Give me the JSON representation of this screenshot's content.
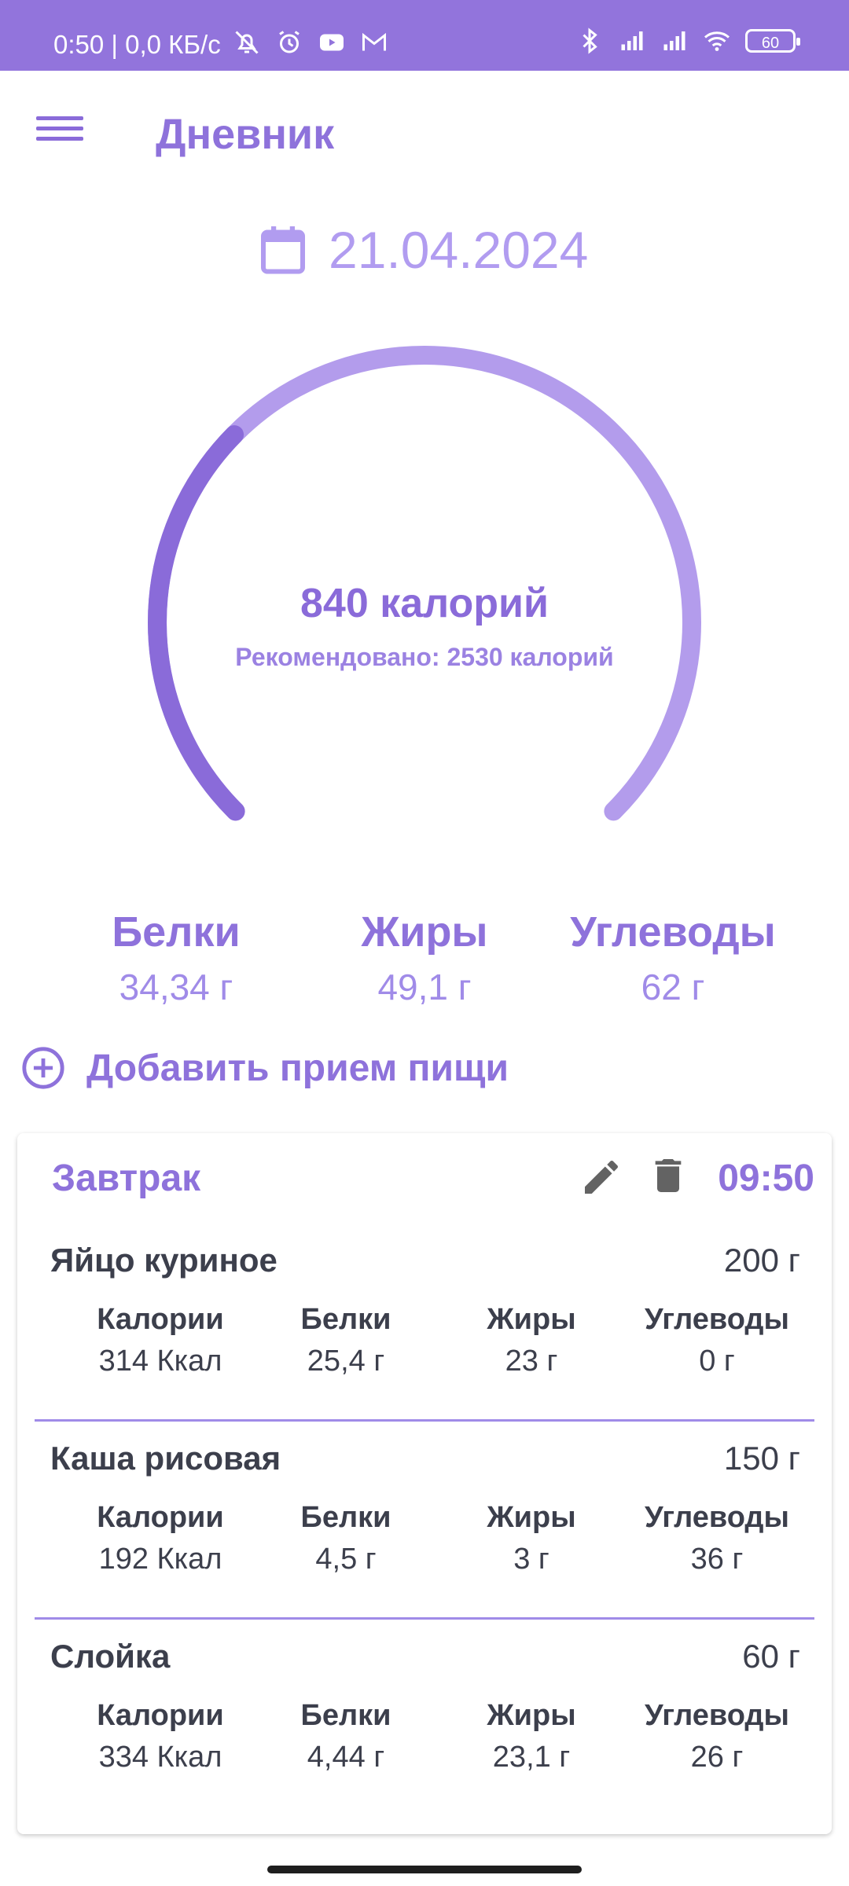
{
  "status_bar": {
    "time_text": "0:50 | 0,0 КБ/с",
    "battery": "60",
    "icons": [
      "bell-off-icon",
      "alarm-icon",
      "youtube-icon",
      "gmail-icon",
      "bluetooth-icon",
      "signal-icon",
      "signal-icon",
      "wifi-icon",
      "battery-icon"
    ]
  },
  "header": {
    "title": "Дневник"
  },
  "date": {
    "value": "21.04.2024",
    "icon": "calendar-icon"
  },
  "calories": {
    "current_label": "840 калорий",
    "recommended_label": "Рекомендовано: 2530 калорий",
    "current": 840,
    "recommended": 2530,
    "colors": {
      "progress": "#8a6bd9",
      "track": "#b39cec"
    }
  },
  "macros": [
    {
      "label": "Белки",
      "value": "34,34 г"
    },
    {
      "label": "Жиры",
      "value": "49,1 г"
    },
    {
      "label": "Углеводы",
      "value": "62 г"
    }
  ],
  "add_meal": {
    "label": "Добавить прием пищи",
    "icon": "add-circle-icon"
  },
  "meal": {
    "title": "Завтрак",
    "time": "09:50",
    "items": [
      {
        "name": "Яйцо куриное",
        "weight": "200 г",
        "nutrients": [
          {
            "label": "Калории",
            "value": "314 Ккал"
          },
          {
            "label": "Белки",
            "value": "25,4 г"
          },
          {
            "label": "Жиры",
            "value": "23 г"
          },
          {
            "label": "Углеводы",
            "value": "0 г"
          }
        ]
      },
      {
        "name": "Каша рисовая",
        "weight": "150 г",
        "nutrients": [
          {
            "label": "Калории",
            "value": "192 Ккал"
          },
          {
            "label": "Белки",
            "value": "4,5 г"
          },
          {
            "label": "Жиры",
            "value": "3 г"
          },
          {
            "label": "Углеводы",
            "value": "36 г"
          }
        ]
      },
      {
        "name": "Слойка",
        "weight": "60 г",
        "nutrients": [
          {
            "label": "Калории",
            "value": "334 Ккал"
          },
          {
            "label": "Белки",
            "value": "4,44 г"
          },
          {
            "label": "Жиры",
            "value": "23,1 г"
          },
          {
            "label": "Углеводы",
            "value": "26 г"
          }
        ]
      }
    ]
  },
  "accent_colors": {
    "header": "#9274dc",
    "primary": "#8e72db",
    "light": "#b19cf0"
  }
}
